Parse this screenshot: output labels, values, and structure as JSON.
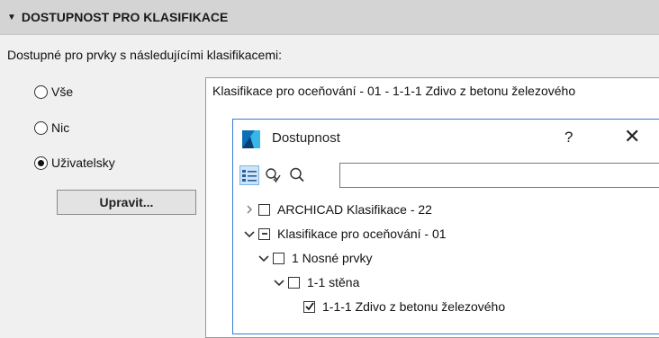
{
  "section": {
    "title": "DOSTUPNOST PRO KLASIFIKACE",
    "intro": "Dostupné pro prvky s následujícími klasifikacemi:"
  },
  "availability_options": [
    {
      "label": "Vše",
      "selected": false
    },
    {
      "label": "Nic",
      "selected": false
    },
    {
      "label": "Uživatelsky",
      "selected": true
    }
  ],
  "edit_button": "Upravit...",
  "classification_field": "Klasifikace pro oceňování - 01 - 1-1-1 Zdivo z betonu železového",
  "dialog": {
    "title": "Dostupnost",
    "help_label": "?",
    "close_label": "✕",
    "search": {
      "value": "",
      "placeholder": ""
    },
    "tree": [
      {
        "label": "ARCHICAD Klasifikace - 22",
        "expander": "collapsed",
        "check": "unchecked",
        "level": 0
      },
      {
        "label": "Klasifikace pro oceňování - 01",
        "expander": "expanded",
        "check": "partial",
        "level": 0
      },
      {
        "label": "1 Nosné prvky",
        "expander": "expanded",
        "check": "unchecked",
        "level": 1
      },
      {
        "label": "1-1 stěna",
        "expander": "expanded",
        "check": "unchecked",
        "level": 2
      },
      {
        "label": "1-1-1 Zdivo z betonu železového",
        "expander": "none",
        "check": "checked",
        "level": 3
      }
    ]
  },
  "colors": {
    "header_bg": "#d4d4d4",
    "panel_bg": "#f0f0f0",
    "dialog_border": "#3a7bd5",
    "selected_tool_bg": "#cce4f7"
  }
}
